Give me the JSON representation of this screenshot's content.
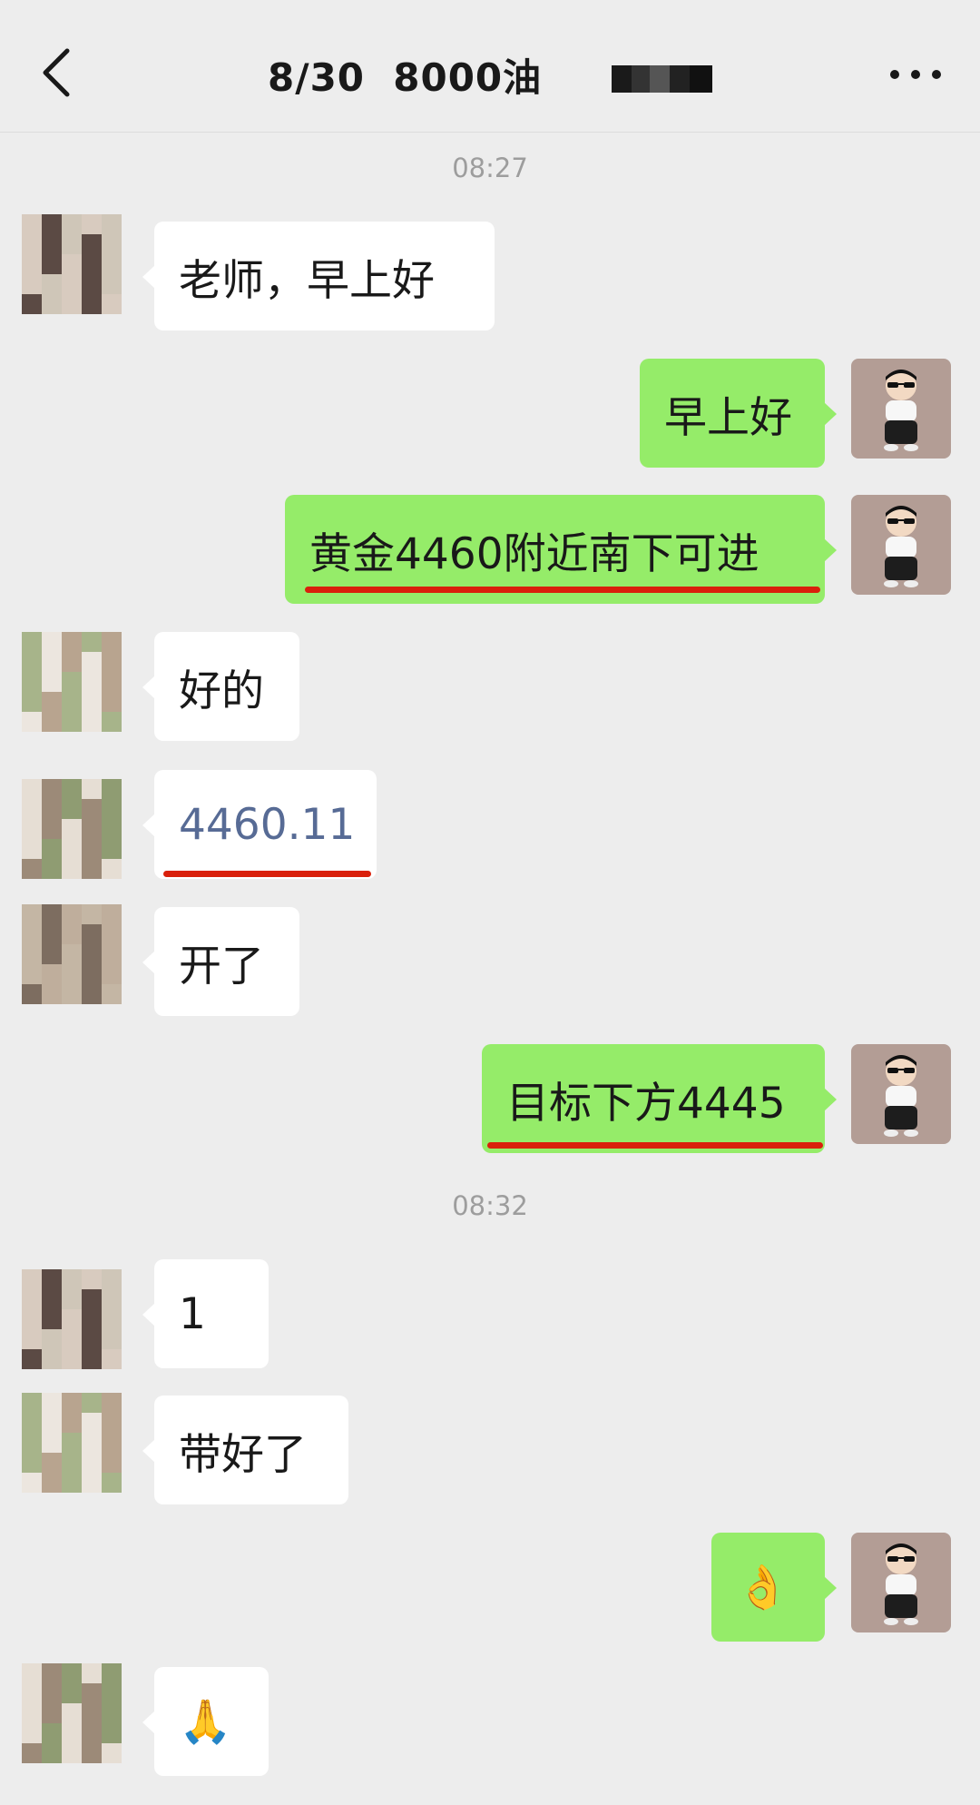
{
  "header": {
    "title": "8/30  8000油",
    "back_icon": "chevron-left-icon",
    "more_icon": "more-horizontal-icon"
  },
  "colors": {
    "background": "#ededed",
    "bubble_self": "#95ec69",
    "bubble_other": "#ffffff",
    "link_text": "#576b95",
    "underline": "#d9200b"
  },
  "timestamps": [
    "08:27",
    "08:32"
  ],
  "messages": [
    {
      "side": "left",
      "text": "老师，早上好"
    },
    {
      "side": "right",
      "text": "早上好"
    },
    {
      "side": "right",
      "text": "黄金4460附近南下可进",
      "underlined": true
    },
    {
      "side": "left",
      "text": "好的"
    },
    {
      "side": "left",
      "text": "4460.11",
      "underlined": true
    },
    {
      "side": "left",
      "text": "开了"
    },
    {
      "side": "right",
      "text": "目标下方4445",
      "underlined": true
    },
    {
      "side": "left",
      "text": "1"
    },
    {
      "side": "left",
      "text": "带好了"
    },
    {
      "side": "right",
      "text": "👌",
      "icon": "ok-hand-emoji-icon"
    },
    {
      "side": "left",
      "text": "🙏",
      "icon": "pray-emoji-icon"
    }
  ]
}
